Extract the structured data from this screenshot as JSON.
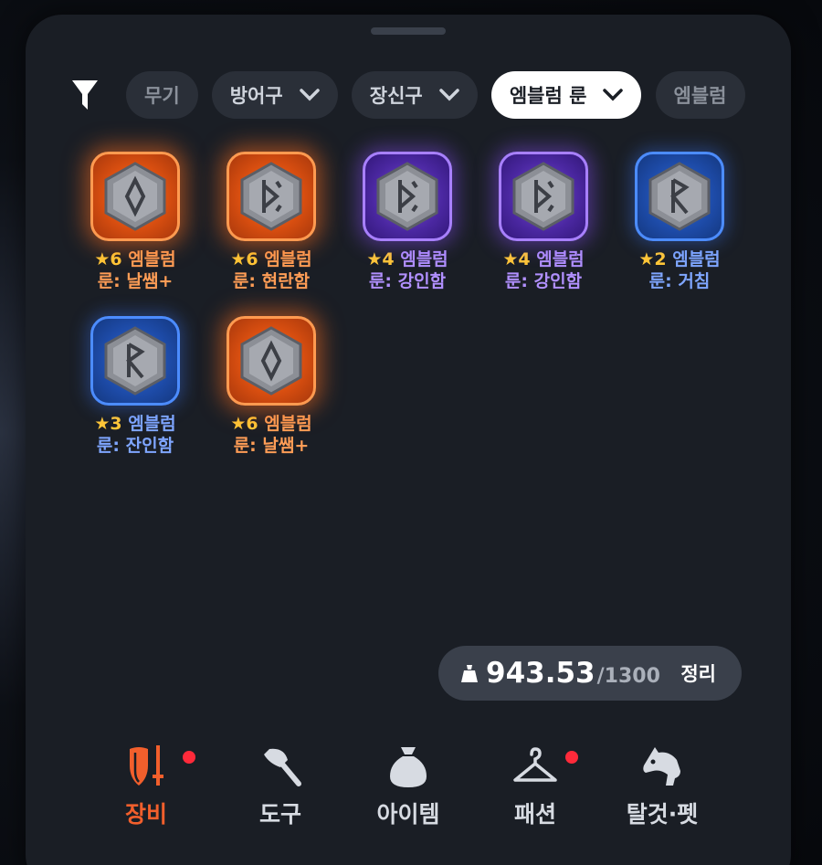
{
  "colors": {
    "panel": "#1a1e25",
    "chip": "#2a2f38",
    "active_chip": "#ffffff",
    "rarity_orange": "#ff7a2a",
    "rarity_purple": "#7a4cd8",
    "rarity_blue": "#2f6ad8",
    "star": "#ffc637",
    "nav_active": "#f25f2c",
    "badge": "#ff2a3a"
  },
  "filter": {
    "icon": "funnel-icon",
    "chips": [
      {
        "label": "무기",
        "has_dropdown": false,
        "active": false
      },
      {
        "label": "방어구",
        "has_dropdown": true,
        "active": false
      },
      {
        "label": "장신구",
        "has_dropdown": true,
        "active": false
      },
      {
        "label": "엠블럼 룬",
        "has_dropdown": true,
        "active": true
      },
      {
        "label": "엠블럼",
        "has_dropdown": false,
        "active": false
      }
    ]
  },
  "items": [
    {
      "stars": "★6",
      "line1": "엠블럼",
      "line2": "룬: 날쌤+",
      "rarity": "orange",
      "rune": "diamond"
    },
    {
      "stars": "★6",
      "line1": "엠블럼",
      "line2": "룬: 현란함",
      "rarity": "orange",
      "rune": "bracket"
    },
    {
      "stars": "★4",
      "line1": "엠블럼",
      "line2": "룬: 강인함",
      "rarity": "purple",
      "rune": "bracket"
    },
    {
      "stars": "★4",
      "line1": "엠블럼",
      "line2": "룬: 강인함",
      "rarity": "purple",
      "rune": "bracket"
    },
    {
      "stars": "★2",
      "line1": "엠블럼",
      "line2": "룬: 거침",
      "rarity": "blue",
      "rune": "r"
    },
    {
      "stars": "★3",
      "line1": "엠블럼",
      "line2": "룬: 잔인함",
      "rarity": "blue",
      "rune": "r"
    },
    {
      "stars": "★6",
      "line1": "엠블럼",
      "line2": "룬: 날쌤+",
      "rarity": "orange",
      "rune": "diamond"
    }
  ],
  "weight": {
    "icon": "weight-bag-icon",
    "current": "943.53",
    "max": "/1300",
    "sort_label": "정리"
  },
  "nav": [
    {
      "label": "장비",
      "icon": "shield-sword-icon",
      "active": true,
      "badge": true
    },
    {
      "label": "도구",
      "icon": "axe-icon",
      "active": false,
      "badge": false
    },
    {
      "label": "아이템",
      "icon": "sack-icon",
      "active": false,
      "badge": false
    },
    {
      "label": "패션",
      "icon": "hanger-icon",
      "active": false,
      "badge": true
    },
    {
      "label": "탈것·펫",
      "icon": "horse-icon",
      "active": false,
      "badge": false
    }
  ]
}
